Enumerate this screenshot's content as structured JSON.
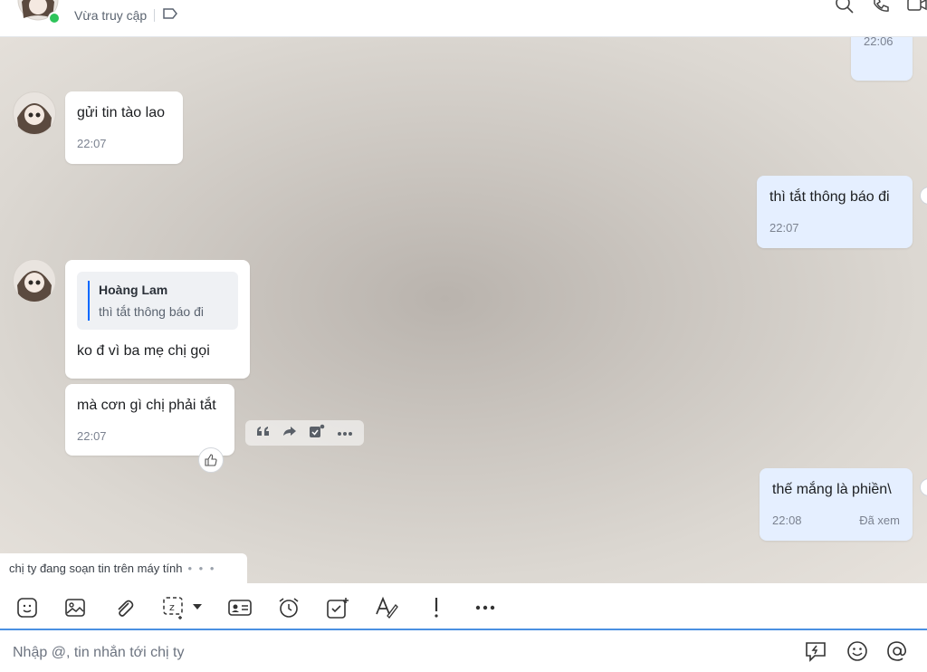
{
  "header": {
    "status": "Vừa truy cập"
  },
  "messages": {
    "m0_time": "22:06",
    "m1_text": "gửi tin tào lao",
    "m1_time": "22:07",
    "m2_text": "thì tắt thông báo đi",
    "m2_time": "22:07",
    "m3_quote_name": "Hoàng Lam",
    "m3_quote_text": "thì tắt thông báo đi",
    "m3_text": "ko đ vì ba mẹ chị gọi",
    "m4_text": "mà cơn gì chị phải tắt",
    "m4_time": "22:07",
    "m5_text": "thế mắng là phiền\\",
    "m5_time": "22:08",
    "m5_status": "Đã xem"
  },
  "typing": {
    "text": "chị ty đang soạn tin trên máy tính",
    "dots": "• • •"
  },
  "toolbar": {
    "items": [
      "sticker-icon",
      "image-icon",
      "attachment-icon",
      "screenshot-icon",
      "contact-card-icon",
      "reminder-icon",
      "task-icon",
      "format-text-icon",
      "urgent-icon",
      "more-icon"
    ]
  },
  "composer": {
    "placeholder": "Nhập @, tin nhắn tới chị ty"
  },
  "colors": {
    "my_bubble": "#e5efff",
    "their_bubble": "#ffffff",
    "accent": "#0068ff"
  }
}
